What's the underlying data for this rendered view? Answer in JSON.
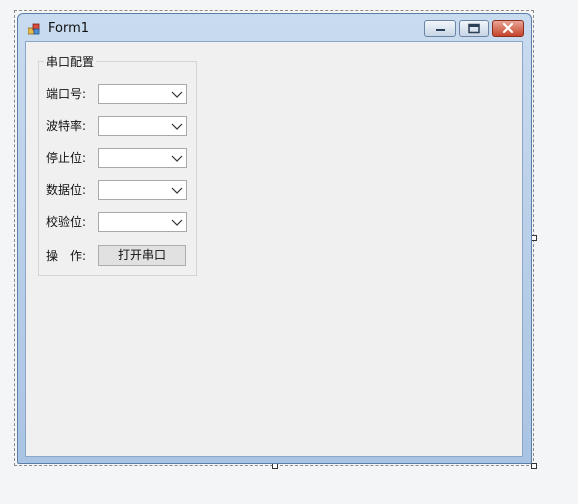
{
  "window": {
    "title": "Form1"
  },
  "group": {
    "title": "串口配置",
    "fields": [
      {
        "label": "端口号:",
        "value": ""
      },
      {
        "label": "波特率:",
        "value": ""
      },
      {
        "label": "停止位:",
        "value": ""
      },
      {
        "label": "数据位:",
        "value": ""
      },
      {
        "label": "校验位:",
        "value": ""
      }
    ],
    "action_label": "操　作:",
    "action_button": "打开串口"
  },
  "icons": {
    "app": "windows-form-icon",
    "minimize": "minimize-icon",
    "maximize": "maximize-icon",
    "close": "close-icon",
    "combo_arrow": "chevron-down-icon"
  },
  "colors": {
    "titlebar": "#b9d1ea",
    "client": "#f0f0f0",
    "close_button": "#c5432b"
  }
}
